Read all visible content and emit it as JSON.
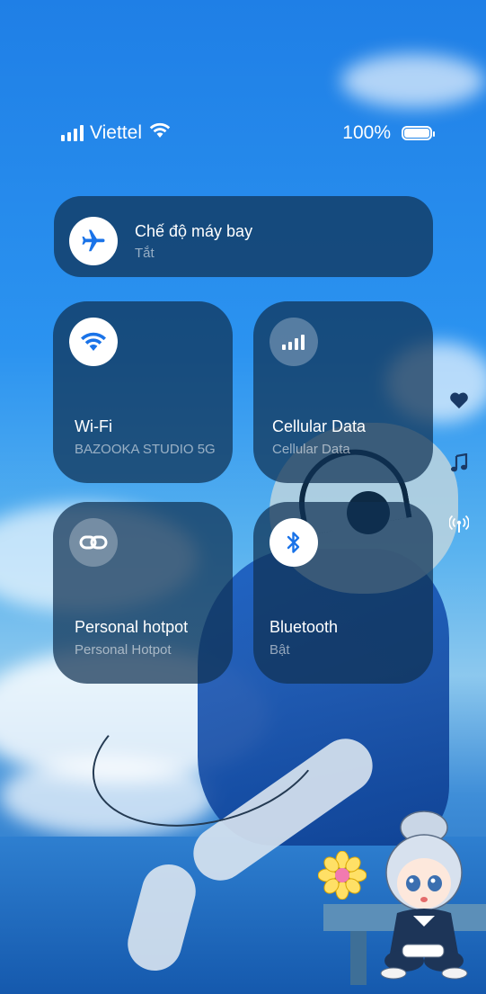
{
  "status_bar": {
    "carrier": "Viettel",
    "battery_percent": "100%",
    "signal_level": 4,
    "battery_level": 1.0
  },
  "airplane_mode": {
    "title": "Chế độ máy bay",
    "status": "Tắt",
    "icon": "airplane-icon",
    "active": false
  },
  "wifi": {
    "title": "Wi-Fi",
    "status": "BAZOOKA STUDIO 5G",
    "icon": "wifi-icon",
    "active": true
  },
  "cellular": {
    "title": "Cellular Data",
    "status": "Cellular Data",
    "icon": "signal-bars-icon",
    "active": false
  },
  "hotspot": {
    "title": "Personal hotpot",
    "status": "Personal Hotpot",
    "icon": "link-icon",
    "active": false
  },
  "bluetooth": {
    "title": "Bluetooth",
    "status": "Bật",
    "icon": "bluetooth-icon",
    "active": true
  },
  "side_icons": [
    "heart-icon",
    "music-note-icon",
    "broadcast-icon"
  ],
  "colors": {
    "accent": "#1a73e8",
    "tile_bg": "#0f3052",
    "text_primary": "#ffffff"
  }
}
